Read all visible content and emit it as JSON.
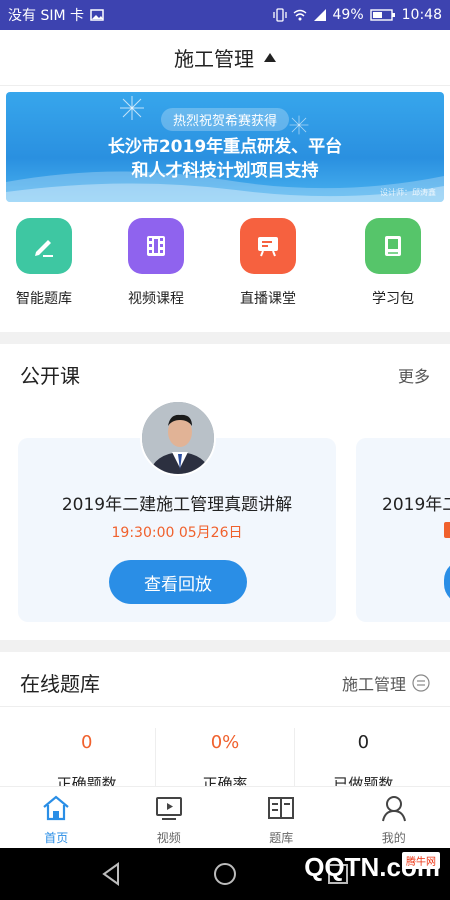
{
  "status_bar": {
    "carrier": "没有 SIM 卡",
    "battery": "49%",
    "time": "10:48"
  },
  "header": {
    "title": "施工管理"
  },
  "banner": {
    "pill": "热烈祝贺希赛获得",
    "line1": "长沙市2019年重点研发、平台",
    "line2": "和人才科技计划项目支持",
    "credit": "设计师：邱涛鑫"
  },
  "quick_menu": [
    {
      "label": "智能题库",
      "icon": "pencil-icon",
      "color": "#3ec7a2"
    },
    {
      "label": "视频课程",
      "icon": "film-icon",
      "color": "#8f63ee"
    },
    {
      "label": "直播课堂",
      "icon": "broadcast-board-icon",
      "color": "#f6613f"
    },
    {
      "label": "学习包",
      "icon": "book-icon",
      "color": "#56c56a"
    }
  ],
  "open_course": {
    "title": "公开课",
    "more": "更多",
    "cards": [
      {
        "title": "2019年二建施工管理真题讲解",
        "time": "19:30:00  05月26日",
        "button": "查看回放"
      },
      {
        "title": "2019年二"
      }
    ]
  },
  "question_bank": {
    "title": "在线题库",
    "subject": "施工管理",
    "stats": [
      {
        "value": "0",
        "label": "正确题数",
        "color": "#f0612d"
      },
      {
        "value": "0%",
        "label": "正确率",
        "color": "#f0612d"
      },
      {
        "value": "0",
        "label": "已做题数",
        "color": "#222222"
      }
    ]
  },
  "tab_bar": [
    {
      "label": "首页",
      "icon": "home-icon",
      "active": true
    },
    {
      "label": "视频",
      "icon": "video-icon",
      "active": false
    },
    {
      "label": "题库",
      "icon": "question-bank-icon",
      "active": false
    },
    {
      "label": "我的",
      "icon": "profile-icon",
      "active": false
    }
  ],
  "watermark": {
    "text": "QQTN.com",
    "badge": "腾牛网"
  },
  "colors": {
    "accent": "#2a8ee6",
    "status_bar": "#3d43b0",
    "highlight": "#f0612d"
  }
}
